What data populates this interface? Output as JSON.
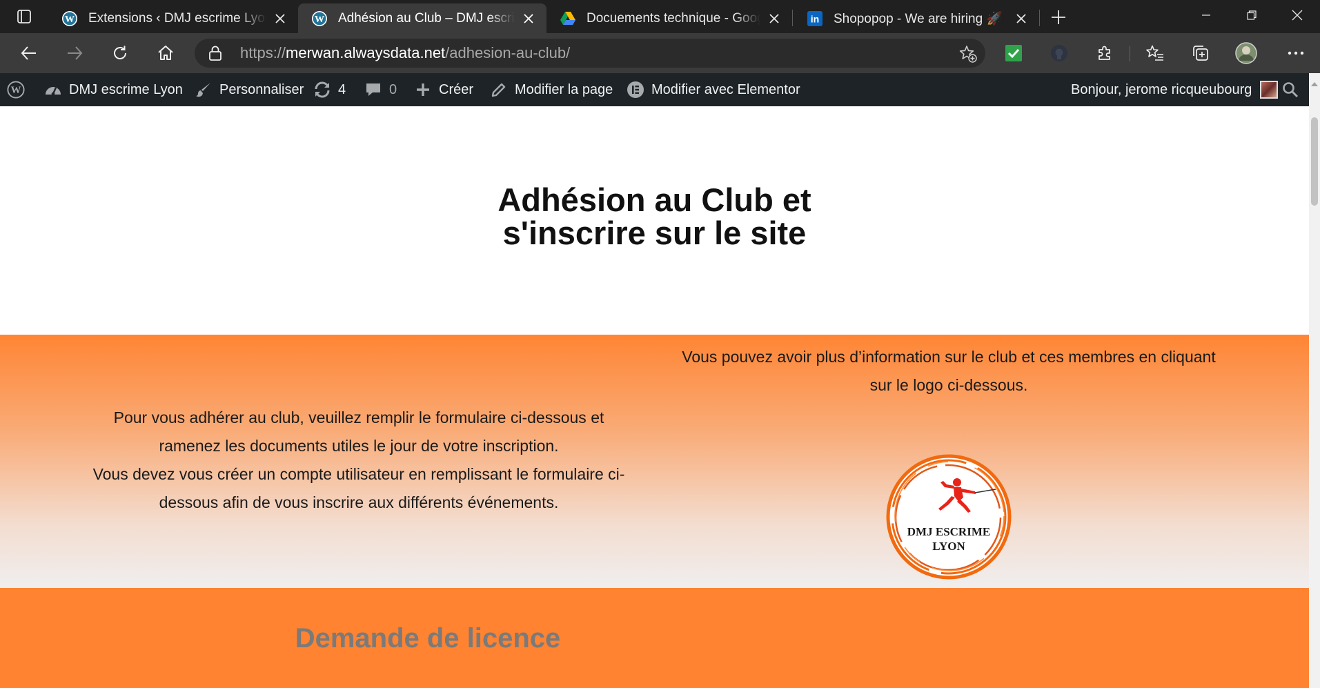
{
  "browser": {
    "tabs": [
      {
        "title": "Extensions ‹ DMJ escrime Lyon — WordPress",
        "favicon": "wordpress-icon",
        "active": false
      },
      {
        "title": "Adhésion au Club – DMJ escrime Lyon",
        "favicon": "wordpress-icon",
        "active": true
      },
      {
        "title": "Docuements technique - Google Drive",
        "favicon": "google-drive-icon",
        "active": false
      },
      {
        "title": "Shopopop - We are hiring 🚀 : P",
        "favicon": "linkedin-icon",
        "active": false
      }
    ],
    "url": {
      "scheme": "https://",
      "host": "merwan.alwaysdata.net",
      "path": "/adhesion-au-club/"
    },
    "colors": {
      "tabbar": "#202020",
      "toolbar": "#3b3b3b",
      "accent_ext": "#2fa34a"
    }
  },
  "adminbar": {
    "site_name": "DMJ escrime Lyon",
    "customize": "Personnaliser",
    "updates_count": "4",
    "comments_count": "0",
    "new": "Créer",
    "edit_page": "Modifier la page",
    "edit_elementor": "Modifier avec Elementor",
    "greeting": "Bonjour, jerome ricqueubourg"
  },
  "page": {
    "title_line1": "Adhésion au Club et",
    "title_line2": "s'inscrire sur le site",
    "left_para_line1": "Pour vous adhérer au club, veuillez remplir le formulaire ci-dessous et",
    "left_para_line2": "ramenez les documents utiles le jour de votre inscription.",
    "left_para_line3": "Vous devez vous créer un compte utilisateur en remplissant le formulaire ci-",
    "left_para_line4": "dessous afin de vous inscrire aux différents événements.",
    "right_para_line1": "Vous pouvez avoir plus d’information sur le club et ces membres en cliquant",
    "right_para_line2": "sur le logo ci-dessous.",
    "logo_line1": "DMJ ESCRIME",
    "logo_line2": "LYON",
    "licence_title": "Demande de licence",
    "colors": {
      "orange": "#ff8330",
      "licence_title": "#7a7a7a",
      "fencer": "#e8231a"
    }
  }
}
